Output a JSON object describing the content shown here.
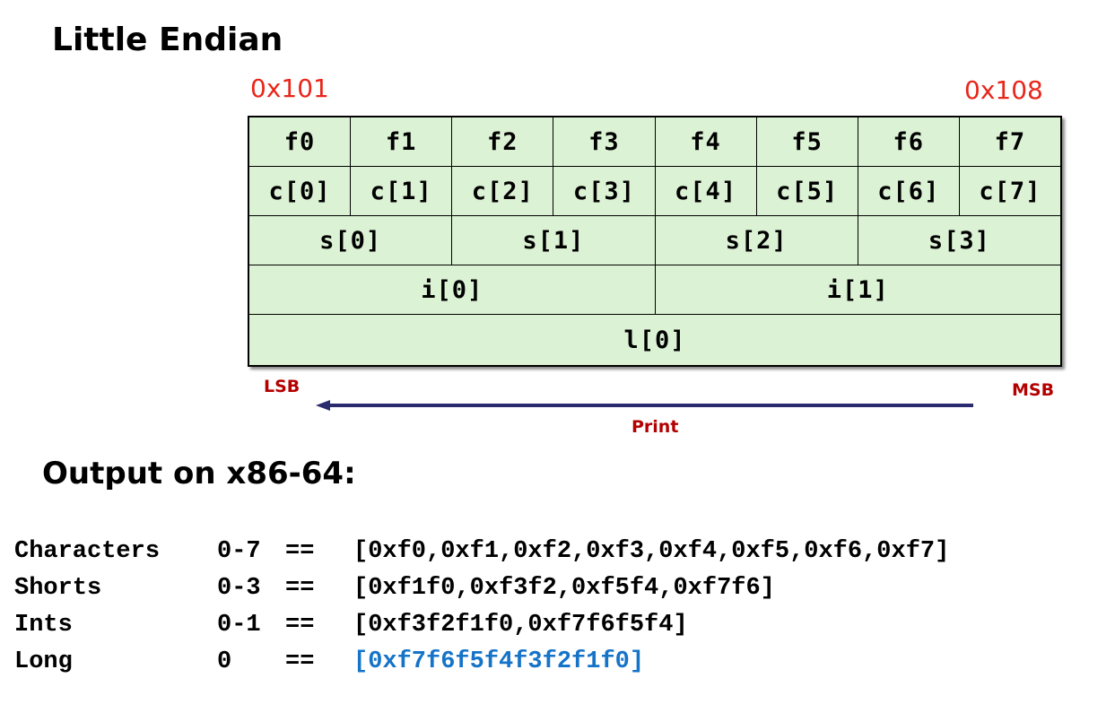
{
  "title": "Little Endian",
  "addresses": {
    "start": "0x101",
    "end": "0x108"
  },
  "rows": [
    [
      "f0",
      "f1",
      "f2",
      "f3",
      "f4",
      "f5",
      "f6",
      "f7"
    ],
    [
      "c[0]",
      "c[1]",
      "c[2]",
      "c[3]",
      "c[4]",
      "c[5]",
      "c[6]",
      "c[7]"
    ],
    [
      "s[0]",
      "s[1]",
      "s[2]",
      "s[3]"
    ],
    [
      "i[0]",
      "i[1]"
    ],
    [
      "l[0]"
    ]
  ],
  "lsb_label": "LSB",
  "msb_label": "MSB",
  "arrow_label": "Print",
  "output_title": "Output on x86-64:",
  "output_lines": [
    {
      "label": "Characters",
      "range": "0-7",
      "eq": "==",
      "value": "[0xf0,0xf1,0xf2,0xf3,0xf4,0xf5,0xf6,0xf7]",
      "highlight": false
    },
    {
      "label": "Shorts",
      "range": "0-3",
      "eq": "==",
      "value": "[0xf1f0,0xf3f2,0xf5f4,0xf7f6]",
      "highlight": false
    },
    {
      "label": "Ints",
      "range": "0-1",
      "eq": "==",
      "value": "[0xf3f2f1f0,0xf7f6f5f4]",
      "highlight": false
    },
    {
      "label": "Long",
      "range": "0",
      "eq": "==",
      "value": "[0xf7f6f5f4f3f2f1f0]",
      "highlight": true
    }
  ],
  "colors": {
    "cell_fill": "#dcf2d4",
    "address": "#e8261b",
    "label_red": "#b40000",
    "arrow": "#2a2a6e",
    "highlight": "#1573c8"
  }
}
